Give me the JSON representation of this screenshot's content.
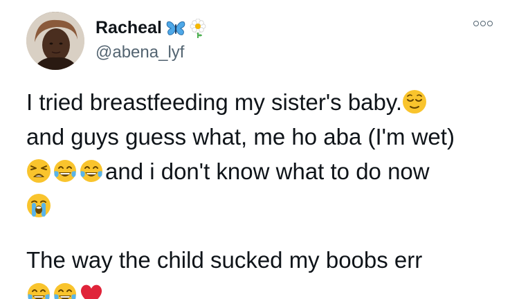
{
  "user": {
    "name": "Racheal",
    "handle": "@abena_lyf",
    "name_icons": [
      "butterfly-icon",
      "flower-icon"
    ]
  },
  "tweet": {
    "line1_text": "I tried breastfeeding my sister's baby.",
    "line2_text": "and guys guess what, me ho aba (I'm wet)",
    "line3_text": "and i don't know what to do now",
    "para2_text": "The way the child sucked my boobs err",
    "emojis": [
      "relieved-face-icon",
      "weary-face-icon",
      "tears-of-joy-icon",
      "tears-of-joy-icon",
      "loudly-crying-icon",
      "tears-of-joy-icon",
      "tears-of-joy-icon",
      "red-heart-icon"
    ]
  },
  "colors": {
    "text": "#0f1419",
    "secondary": "#536471",
    "emoji_yellow": "#f9c42d",
    "heart_red": "#e0243a",
    "tear_blue": "#5ab4e8"
  }
}
